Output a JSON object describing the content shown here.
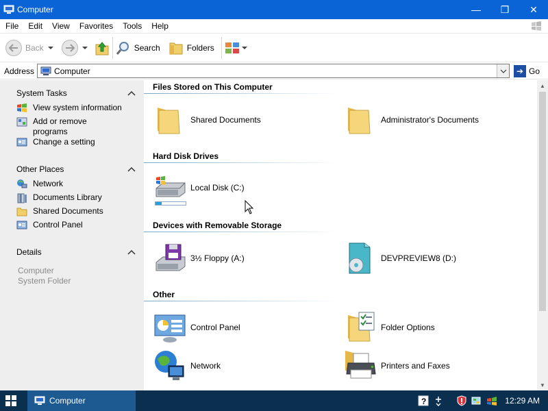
{
  "window": {
    "title": "Computer",
    "minimize": "—",
    "maximize": "❐",
    "close": "✕"
  },
  "menu": [
    "File",
    "Edit",
    "View",
    "Favorites",
    "Tools",
    "Help"
  ],
  "toolbar": {
    "back": "Back",
    "search": "Search",
    "folders": "Folders"
  },
  "address": {
    "label": "Address",
    "value": "Computer",
    "go": "Go"
  },
  "left": {
    "system_tasks": {
      "title": "System Tasks",
      "items": [
        "View system information",
        "Add or remove programs",
        "Change a setting"
      ]
    },
    "other_places": {
      "title": "Other Places",
      "items": [
        "Network",
        "Documents Library",
        "Shared Documents",
        "Control Panel"
      ]
    },
    "details": {
      "title": "Details",
      "name": "Computer",
      "type": "System Folder"
    }
  },
  "groups": {
    "files": {
      "title": "Files Stored on This Computer",
      "items": [
        "Shared Documents",
        "Administrator's Documents"
      ]
    },
    "hdd": {
      "title": "Hard Disk Drives",
      "items": [
        "Local Disk (C:)"
      ],
      "local_disk_used": 0.2
    },
    "removable": {
      "title": "Devices with Removable Storage",
      "items": [
        "3½ Floppy (A:)",
        "DEVPREVIEW8 (D:)"
      ]
    },
    "other": {
      "title": "Other",
      "items": [
        "Control Panel",
        "Folder Options",
        "Network",
        "Printers and Faxes"
      ]
    }
  },
  "taskbar": {
    "task": "Computer",
    "time": "12:29 AM"
  },
  "colors": {
    "titlebar": "#0a64d6",
    "taskbar": "#0b2f4f",
    "leftpane": "#eeeeee",
    "folder": "#f1cf6a"
  }
}
